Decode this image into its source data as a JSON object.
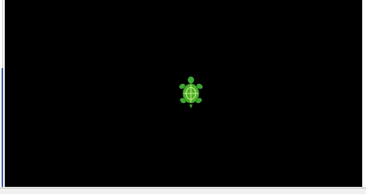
{
  "app": {
    "canvas_background": "#000000",
    "turtle_color": "#3fa535",
    "turtle_shell_color": "#4caf2f",
    "turtle_line_color": "#c8f080"
  },
  "icons": {
    "turtle": "turtle-icon"
  }
}
